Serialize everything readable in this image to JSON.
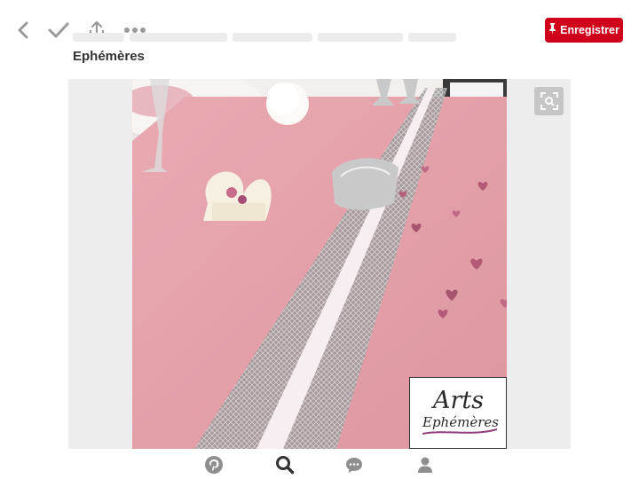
{
  "toolbar": {
    "icons": [
      "back-arrow-icon",
      "checkmark-icon",
      "share-icon",
      "more-dots-icon"
    ],
    "save_label": "Enregistrer",
    "save_color": "#d0021b"
  },
  "pin": {
    "title_line2": "Ephémères"
  },
  "image": {
    "logo_text_line1": "Arts",
    "logo_text_line2": "Ephémères",
    "runner_color": "#e6a5ad",
    "panel_bg": "#ededed"
  },
  "tabbar": {
    "tabs": [
      "pinterest-home-icon",
      "search-icon",
      "chat-icon",
      "profile-icon"
    ],
    "active": "search-icon"
  }
}
